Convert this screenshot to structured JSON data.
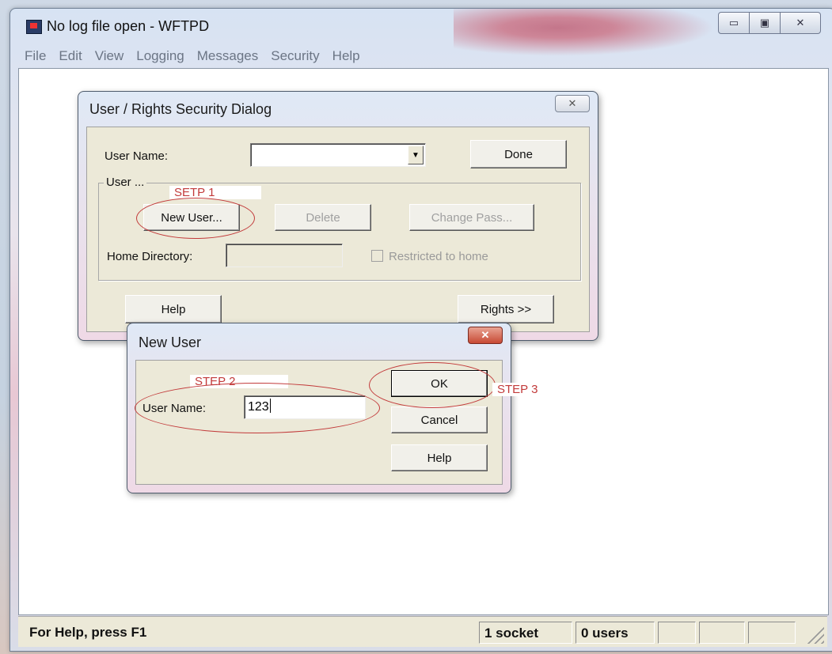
{
  "window": {
    "title": "No log file open - WFTPD",
    "menu": [
      "File",
      "Edit",
      "View",
      "Logging",
      "Messages",
      "Security",
      "Help"
    ],
    "controls": {
      "minimize": "▭",
      "maximize": "▣",
      "close": "✕"
    }
  },
  "status_bar": {
    "help": "For Help, press F1",
    "sockets": "1 socket",
    "users": "0 users"
  },
  "rights_dialog": {
    "title": "User / Rights Security Dialog",
    "close": "✕",
    "user_name_label": "User Name:",
    "user_name_value": "",
    "done": "Done",
    "group_caption": "User ...",
    "new_user": "New User...",
    "delete": "Delete",
    "change_pass": "Change Pass...",
    "home_directory_label": "Home Directory:",
    "restricted_label": "Restricted to home",
    "help": "Help",
    "rights": "Rights >>"
  },
  "new_user_dialog": {
    "title": "New User",
    "close": "✕",
    "user_name_label": "User Name:",
    "user_name_value": "123",
    "ok": "OK",
    "cancel": "Cancel",
    "help": "Help"
  },
  "annotations": {
    "step1": "SETP 1",
    "step2": "STEP 2",
    "step3": "STEP 3"
  },
  "colors": {
    "annotation": "#c23a3a",
    "dialog_face": "#ece9d8"
  }
}
